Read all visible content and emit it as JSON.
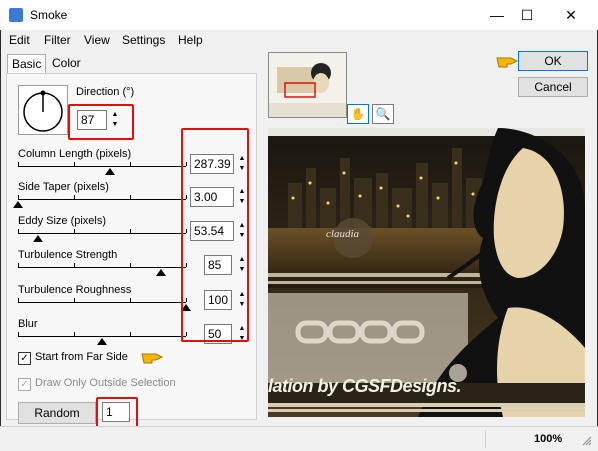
{
  "window": {
    "title": "Smoke",
    "minimize": "—",
    "maximize": "☐",
    "close": "✕"
  },
  "menu": [
    "Edit",
    "Filter",
    "View",
    "Settings",
    "Help"
  ],
  "tabs": [
    "Basic",
    "Color"
  ],
  "direction": {
    "label": "Direction (°)",
    "value": "87"
  },
  "params": [
    {
      "label": "Column Length (pixels)",
      "value": "287.39",
      "fraction": 0.55
    },
    {
      "label": "Side Taper (pixels)",
      "value": "3.00",
      "fraction": 0.0
    },
    {
      "label": "Eddy Size (pixels)",
      "value": "53.54",
      "fraction": 0.12
    },
    {
      "label": "Turbulence Strength",
      "value": "85",
      "fraction": 0.85
    },
    {
      "label": "Turbulence Roughness",
      "value": "100",
      "fraction": 1.0
    },
    {
      "label": "Blur",
      "value": "50",
      "fraction": 0.5
    }
  ],
  "options": {
    "start_far_side": {
      "label": "Start from Far Side",
      "checked": true
    },
    "draw_outside": {
      "label": "Draw Only Outside Selection",
      "checked": true
    }
  },
  "random_seed": {
    "label": "Random Seed",
    "value": "1"
  },
  "buttons": {
    "ok": "OK",
    "cancel": "Cancel"
  },
  "preview": {
    "watermark": "claudia",
    "credit": "lation by CGSFDesigns."
  },
  "status": {
    "zoom": "100%"
  },
  "colors": {
    "highlight": "#e01010",
    "pointer": "#f2b705",
    "ok_border": "#0078d7"
  }
}
